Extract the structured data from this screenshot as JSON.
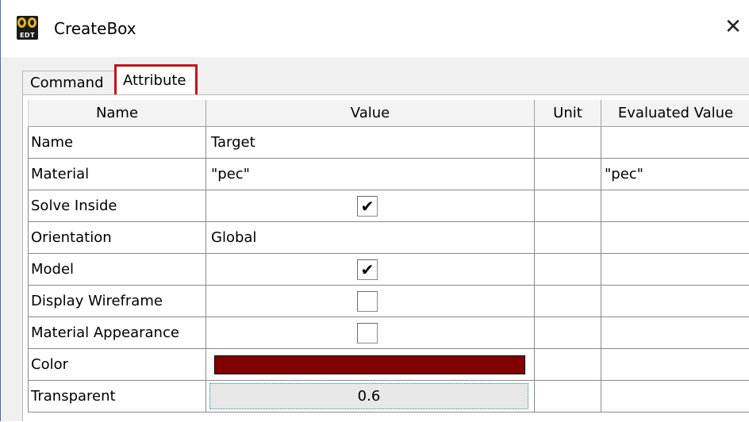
{
  "window": {
    "title": "CreateBox",
    "icon_label": "EDT",
    "close_glyph": "✕"
  },
  "tabs": [
    {
      "label": "Command",
      "selected": false
    },
    {
      "label": "Attribute",
      "selected": true
    }
  ],
  "grid": {
    "columns": [
      "Name",
      "Value",
      "Unit",
      "Evaluated Value"
    ],
    "rows": [
      {
        "name": "Name",
        "value": "Target",
        "unit": "",
        "evaluated": ""
      },
      {
        "name": "Material",
        "value": "\"pec\"",
        "unit": "",
        "evaluated": "\"pec\""
      },
      {
        "name": "Solve Inside",
        "checked": true,
        "check_glyph": "✔",
        "unit": "",
        "evaluated": ""
      },
      {
        "name": "Orientation",
        "value": "Global",
        "unit": "",
        "evaluated": ""
      },
      {
        "name": "Model",
        "checked": true,
        "check_glyph": "✔",
        "unit": "",
        "evaluated": ""
      },
      {
        "name": "Display Wireframe",
        "checked": false,
        "check_glyph": "",
        "unit": "",
        "evaluated": ""
      },
      {
        "name": "Material Appearance",
        "checked": false,
        "check_glyph": "",
        "unit": "",
        "evaluated": ""
      },
      {
        "name": "Color",
        "color": "#800000",
        "unit": "",
        "evaluated": ""
      },
      {
        "name": "Transparent",
        "value": "0.6",
        "unit": "",
        "evaluated": ""
      }
    ]
  },
  "colors": {
    "highlight_border": "#c0141d",
    "color_swatch": "#800000"
  }
}
